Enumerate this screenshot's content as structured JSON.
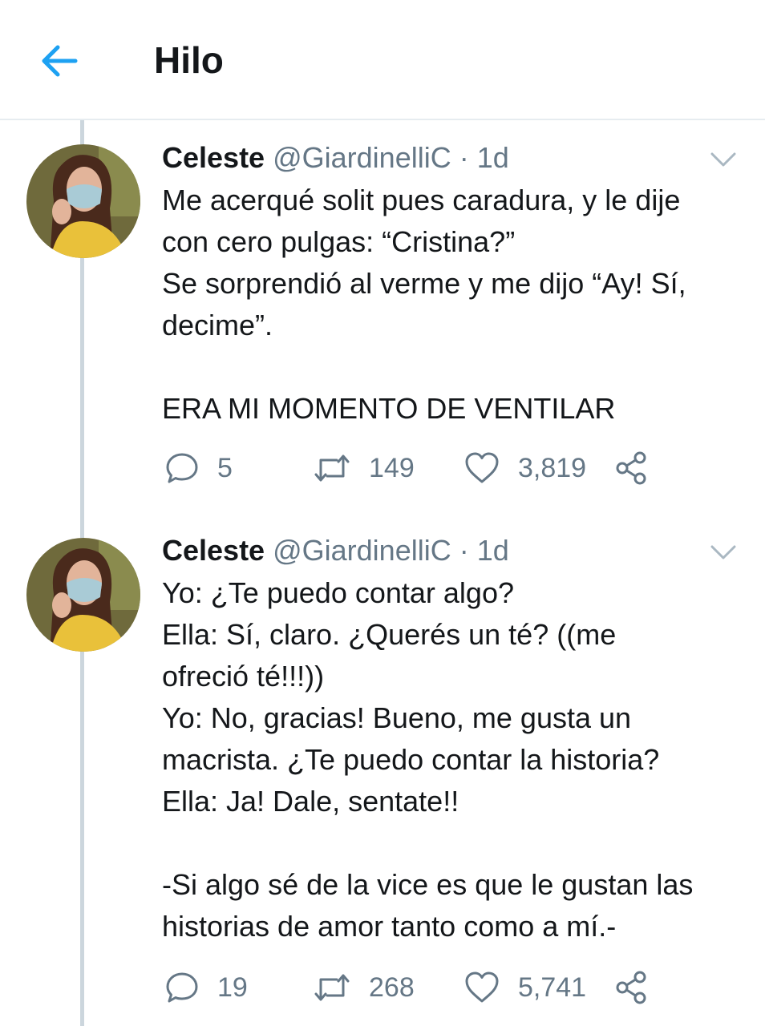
{
  "header": {
    "title": "Hilo",
    "back_icon": "arrow-left-icon",
    "accent": "#1da1f2"
  },
  "tweets": [
    {
      "name": "Celeste",
      "handle": "@GiardinelliC",
      "separator": "·",
      "time": "1d",
      "lines": [
        "Me acerqué solit pues caradura, y le dije",
        "con cero pulgas: “Cristina?”",
        "Se sorprendió al verme y me dijo “Ay! Sí,",
        "decime”.",
        "",
        "ERA MI MOMENTO DE VENTILAR"
      ],
      "replies": "5",
      "retweets": "149",
      "likes": "3,819"
    },
    {
      "name": "Celeste",
      "handle": "@GiardinelliC",
      "separator": "·",
      "time": "1d",
      "lines": [
        "Yo: ¿Te puedo contar algo?",
        "Ella: Sí, claro. ¿Querés un té? ((me",
        "ofreció té!!!))",
        "Yo: No, gracias! Bueno, me gusta un",
        "macrista. ¿Te puedo contar la historia?",
        "Ella: Ja! Dale, sentate!!",
        "",
        "-Si algo sé de la vice es que le gustan las",
        "historias de amor tanto como a mí.-"
      ],
      "replies": "19",
      "retweets": "268",
      "likes": "5,741"
    }
  ],
  "icons": {
    "reply": "speech-bubble-icon",
    "retweet": "retweet-icon",
    "like": "heart-icon",
    "share": "share-icon",
    "caret": "chevron-down-icon"
  },
  "colors": {
    "text": "#14171a",
    "secondary": "#657786",
    "thread_line": "#ccd6dd",
    "divider": "#e6ecf0"
  }
}
